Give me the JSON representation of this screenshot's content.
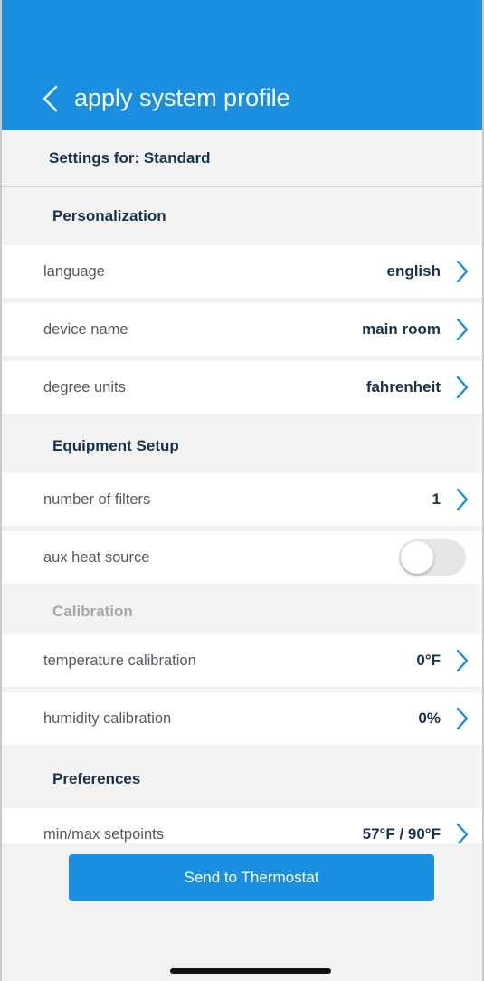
{
  "header": {
    "title": "apply system profile",
    "back_icon": "chevron-left-icon",
    "background": "#1a8fdf"
  },
  "settings_for": "Settings for: Standard",
  "sections": {
    "personalization": {
      "title": "Personalization",
      "rows": [
        {
          "label": "language",
          "value": "english"
        },
        {
          "label": "device name",
          "value": "main room"
        },
        {
          "label": "degree units",
          "value": "fahrenheit"
        }
      ]
    },
    "equipment": {
      "title": "Equipment Setup",
      "rows": [
        {
          "label": "number of filters",
          "value": "1"
        },
        {
          "label": "aux heat source",
          "toggle": false
        }
      ]
    },
    "calibration": {
      "title": "Calibration",
      "rows": [
        {
          "label": "temperature calibration",
          "value": "0°F"
        },
        {
          "label": "humidity calibration",
          "value": "0%"
        }
      ]
    },
    "preferences": {
      "title": "Preferences",
      "rows": [
        {
          "label": "min/max setpoints",
          "value": "57°F / 90°F"
        }
      ]
    }
  },
  "footer": {
    "send_label": "Send to Thermostat"
  },
  "colors": {
    "accent": "#1a8fdf",
    "text_dark": "#17324d",
    "chevron": "#1a8fdf"
  }
}
